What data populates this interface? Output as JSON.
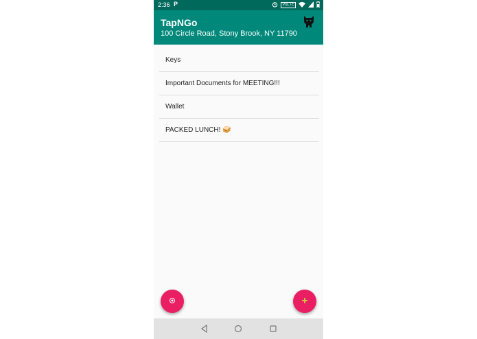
{
  "status_bar": {
    "time": "2:36",
    "app_indicator": "P",
    "icons": [
      "alarm-icon",
      "volte-icon",
      "wifi-icon",
      "signal-icon",
      "battery-icon"
    ],
    "volte_label": "VoLTE"
  },
  "app_bar": {
    "title": "TapNGo",
    "address": "100 Circle Road, Stony Brook, NY 11790",
    "logo_icon": "mascot-logo-icon"
  },
  "items": [
    {
      "label": "Keys"
    },
    {
      "label": "Important Documents for MEETING!!!"
    },
    {
      "label": "Wallet"
    },
    {
      "label": "PACKED LUNCH! 🥪"
    }
  ],
  "fabs": {
    "left_icon": "location-target-icon",
    "right_icon": "add-icon",
    "right_symbol": "+"
  },
  "nav_bar": {
    "icons": [
      "back-icon",
      "home-icon",
      "recents-icon"
    ]
  },
  "colors": {
    "status_bar": "#00695c",
    "app_bar": "#00897b",
    "fab": "#e91e63",
    "fab_plus": "#c6d43a",
    "background": "#fafafa",
    "nav_bar": "#e2e2e2"
  }
}
